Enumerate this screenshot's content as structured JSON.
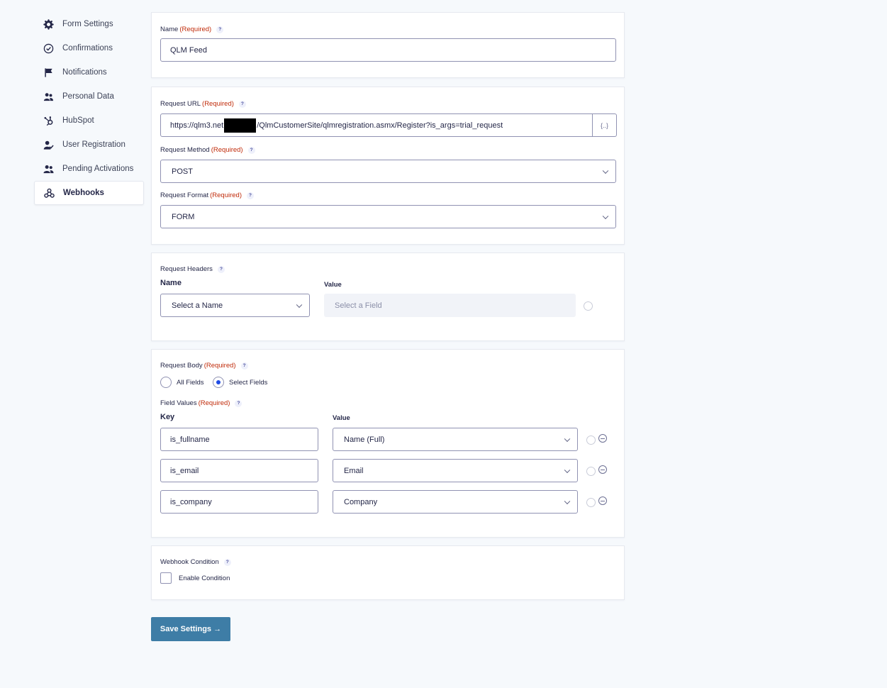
{
  "sidebar": {
    "items": [
      {
        "label": "Form Settings",
        "icon": "gear-icon"
      },
      {
        "label": "Confirmations",
        "icon": "check-circle-icon"
      },
      {
        "label": "Notifications",
        "icon": "flag-icon"
      },
      {
        "label": "Personal Data",
        "icon": "users-icon"
      },
      {
        "label": "HubSpot",
        "icon": "hubspot-icon"
      },
      {
        "label": "User Registration",
        "icon": "user-check-icon"
      },
      {
        "label": "Pending Activations",
        "icon": "user-clock-icon"
      },
      {
        "label": "Webhooks",
        "icon": "webhook-icon"
      }
    ]
  },
  "required_text": "(Required)",
  "help_glyph": "?",
  "name_section": {
    "label": "Name",
    "value": "QLM Feed"
  },
  "request_section": {
    "url_label": "Request URL",
    "url_prefix": "https://qlm3.net",
    "url_suffix": "/QlmCustomerSite/qlmregistration.asmx/Register?is_args=trial_request",
    "merge_tag_glyph": "{..}",
    "method_label": "Request Method",
    "method_value": "POST",
    "format_label": "Request Format",
    "format_value": "FORM"
  },
  "headers_section": {
    "label": "Request Headers",
    "name_col": "Name",
    "value_col": "Value",
    "name_placeholder": "Select a Name",
    "value_placeholder": "Select a Field"
  },
  "body_section": {
    "label": "Request Body",
    "option_all": "All Fields",
    "option_select": "Select Fields",
    "selected": "Select Fields",
    "field_values_label": "Field Values",
    "key_col": "Key",
    "value_col": "Value",
    "rows": [
      {
        "key": "is_fullname",
        "value": "Name (Full)"
      },
      {
        "key": "is_email",
        "value": "Email"
      },
      {
        "key": "is_company",
        "value": "Company"
      }
    ]
  },
  "condition_section": {
    "label": "Webhook Condition",
    "checkbox_label": "Enable Condition",
    "checked": false
  },
  "save_button": "Save Settings  →",
  "colors": {
    "accent": "#3e7da6",
    "required": "#c02b0a",
    "background": "#f6f9fc",
    "radio": "#204ce5"
  }
}
